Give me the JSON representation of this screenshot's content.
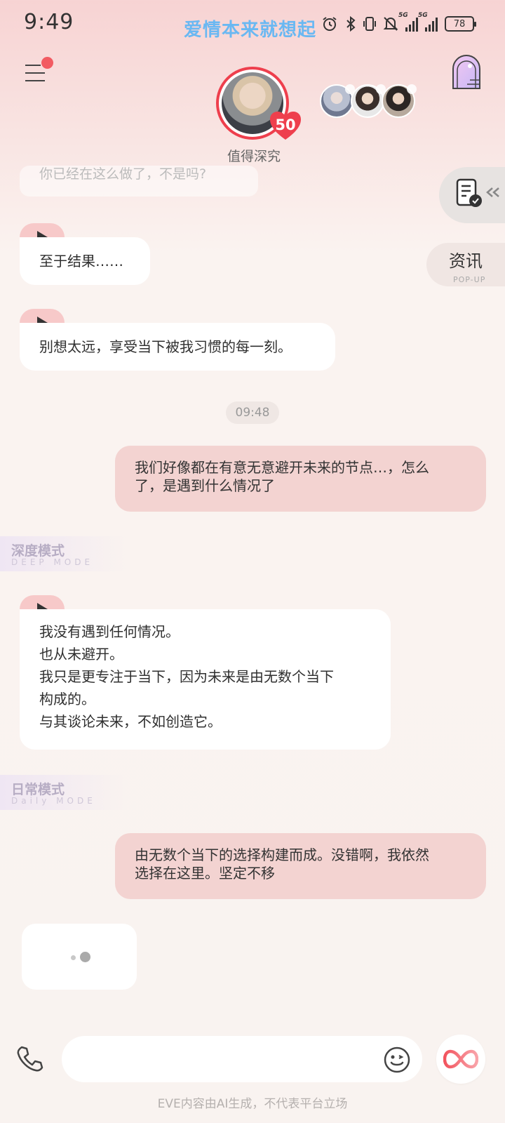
{
  "status_bar": {
    "time": "9:49",
    "banner": "爱情本来就想起",
    "battery": "78",
    "network": [
      "5G",
      "5G"
    ],
    "icons": [
      "alarm-icon",
      "bluetooth-icon",
      "vibrate-icon",
      "mute-icon",
      "signal-icon",
      "signal-icon",
      "battery-icon"
    ]
  },
  "header": {
    "affinity_level": "50",
    "character_subtitle": "值得深究",
    "menu_has_notification": true
  },
  "side_panel": {
    "news_label": "资讯",
    "news_sub": "POP-UP"
  },
  "messages": {
    "faded": "你已经在这么做了，不是吗?",
    "ai_1": "至于结果……",
    "ai_2": "别想太远，享受当下被我习惯的每一刻。",
    "timestamp": "09:48",
    "user_1_line1": "我们好像都在有意无意避开未来的节点…，怎么",
    "user_1_line2": "了，是遇到什么情况了",
    "ai_3_lines": [
      "我没有遇到任何情况。",
      "也从未避开。",
      "我只是更专注于当下，因为未来是由无数个当下",
      "构成的。",
      "与其谈论未来，不如创造它。"
    ],
    "user_2_line1": "由无数个当下的选择构建而成。没错啊，我依然",
    "user_2_line2": "选择在这里。坚定不移"
  },
  "modes": {
    "deep_title": "深度模式",
    "deep_sub": "DEEP MODE",
    "daily_title": "日常模式",
    "daily_sub": "Daily MODE"
  },
  "composer": {
    "input_value": "",
    "input_placeholder": ""
  },
  "footer": {
    "disclaimer": "EVE内容由AI生成，不代表平台立场"
  },
  "colors": {
    "accent_red": "#ee3f4d",
    "user_bubble": "#f3d3d1",
    "play_tab": "#f7c9c9",
    "banner_blue": "#6ab8f2"
  }
}
